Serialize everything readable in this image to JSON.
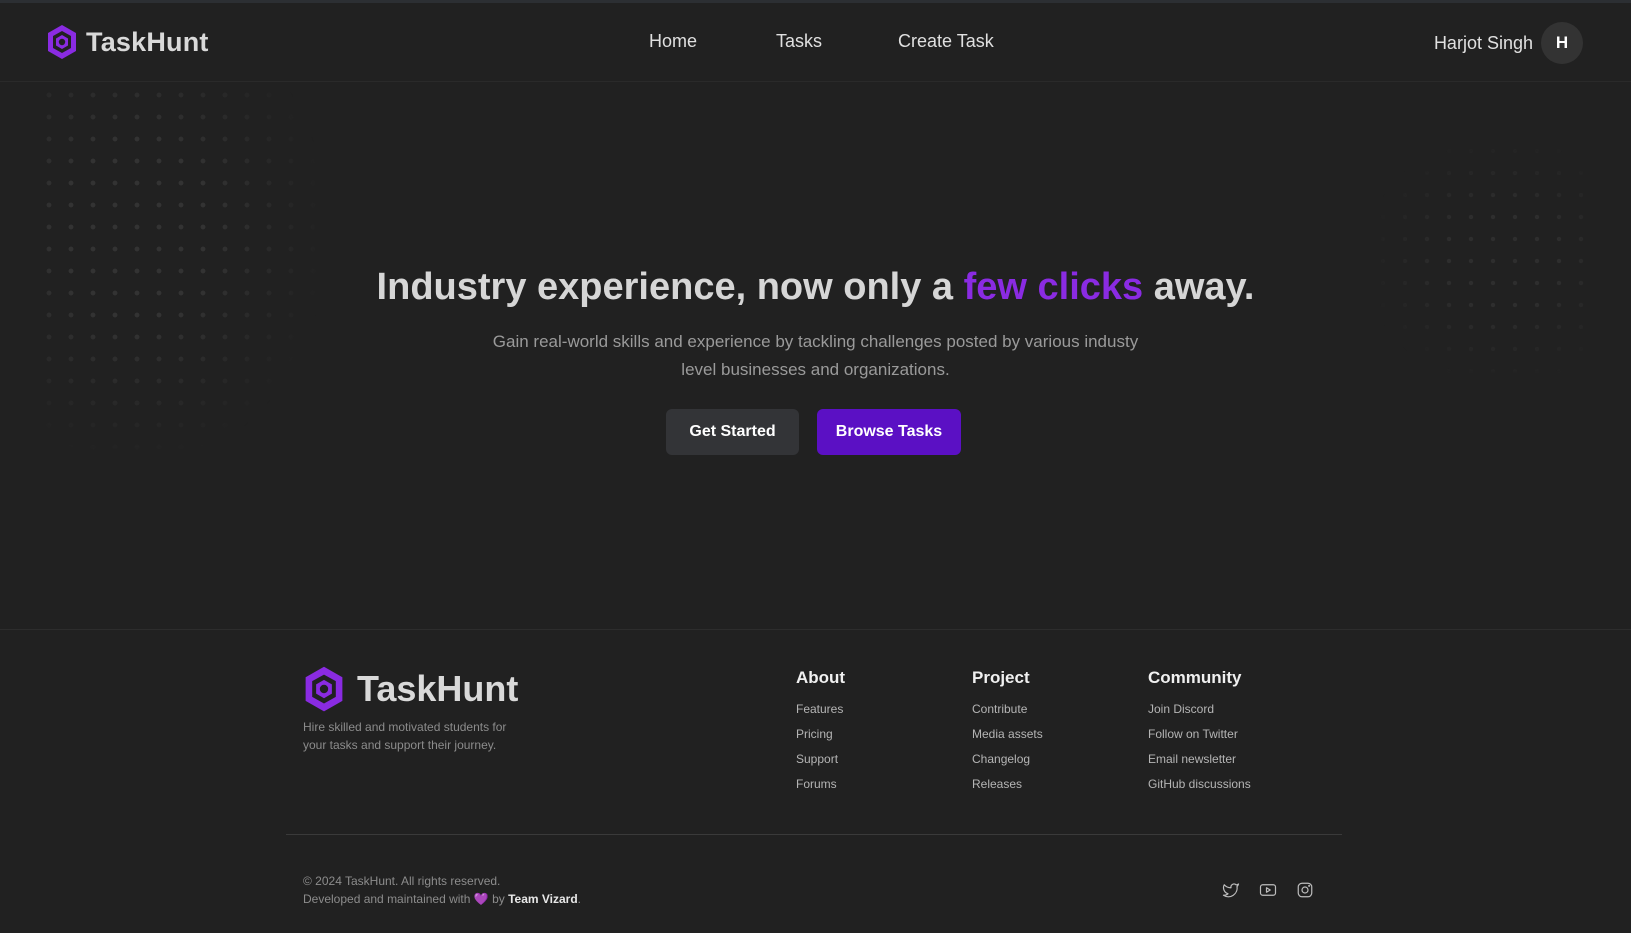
{
  "brand": {
    "name": "TaskHunt",
    "color": "#8a2be2"
  },
  "nav": {
    "links": [
      {
        "label": "Home"
      },
      {
        "label": "Tasks"
      },
      {
        "label": "Create Task"
      }
    ],
    "user": {
      "name": "Harjot Singh",
      "initial": "H"
    }
  },
  "hero": {
    "title_before": "Industry experience, now only a ",
    "title_accent": "few clicks",
    "title_after": " away.",
    "subtitle": "Gain real-world skills and experience by tackling challenges posted by various industy level businesses and organizations.",
    "primary_button": "Get Started",
    "secondary_button": "Browse Tasks",
    "accent_color": "#8a2be2",
    "button_color": "#5b10c4"
  },
  "footer": {
    "brand_name": "TaskHunt",
    "tagline": "Hire skilled and motivated students for your tasks and support their journey.",
    "columns": [
      {
        "title": "About",
        "links": [
          "Features",
          "Pricing",
          "Support",
          "Forums"
        ]
      },
      {
        "title": "Project",
        "links": [
          "Contribute",
          "Media assets",
          "Changelog",
          "Releases"
        ]
      },
      {
        "title": "Community",
        "links": [
          "Join Discord",
          "Follow on Twitter",
          "Email newsletter",
          "GitHub discussions"
        ]
      }
    ],
    "copyright": "© 2024 TaskHunt. All rights reserved.",
    "credit_prefix": "Developed and maintained with ",
    "credit_heart": "💜",
    "credit_by": " by ",
    "credit_team": "Team Vizard",
    "credit_suffix": ".",
    "socials": [
      "twitter-icon",
      "youtube-icon",
      "instagram-icon"
    ]
  }
}
